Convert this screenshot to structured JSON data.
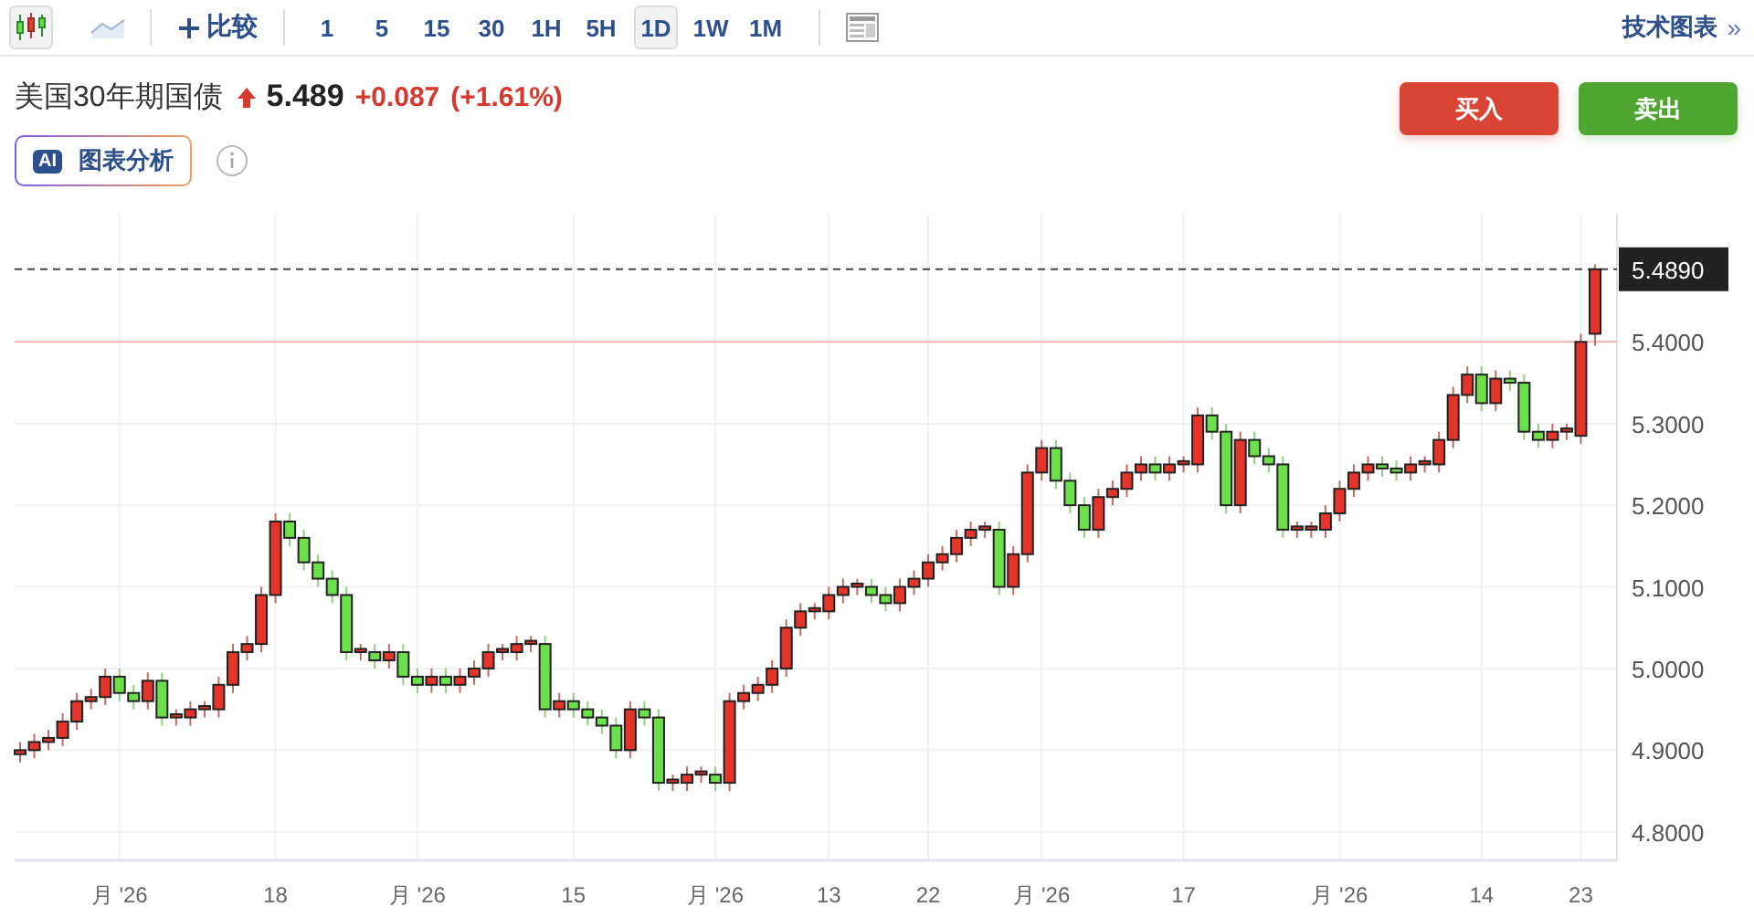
{
  "toolbar": {
    "chart_types": [
      {
        "kind": "candle",
        "selected": true
      },
      {
        "kind": "line",
        "selected": false
      }
    ],
    "compare": {
      "label": "比较"
    },
    "intervals": [
      {
        "label": "1",
        "selected": false
      },
      {
        "label": "5",
        "selected": false
      },
      {
        "label": "15",
        "selected": false
      },
      {
        "label": "30",
        "selected": false
      },
      {
        "label": "1H",
        "selected": false
      },
      {
        "label": "5H",
        "selected": false
      },
      {
        "label": "1D",
        "selected": true
      },
      {
        "label": "1W",
        "selected": false
      },
      {
        "label": "1M",
        "selected": false
      }
    ],
    "link": {
      "label": "技术图表",
      "chevron": "»"
    }
  },
  "quote": {
    "name": "美国30年期国债",
    "up": true,
    "price": "5.489",
    "change": "+0.087",
    "change_pct": "(+1.61%)"
  },
  "actions": [
    {
      "label": "买入",
      "kind": "buy"
    },
    {
      "label": "卖出",
      "kind": "sell"
    }
  ],
  "ai_button": {
    "badge": "AI",
    "label": "图表分析"
  },
  "chart": {
    "chart_data": {
      "type": "candlestick",
      "ylim": [
        4.765,
        5.557
      ],
      "yticks": [
        {
          "value": 5.4,
          "label": "5.4000"
        },
        {
          "value": 5.3,
          "label": "5.3000"
        },
        {
          "value": 5.2,
          "label": "5.2000"
        },
        {
          "value": 5.1,
          "label": "5.1000"
        },
        {
          "value": 5.0,
          "label": "5.0000"
        },
        {
          "value": 4.9,
          "label": "4.9000"
        },
        {
          "value": 4.8,
          "label": "4.8000"
        }
      ],
      "categories": [
        null,
        null,
        null,
        null,
        null,
        null,
        null,
        "月 '26",
        null,
        null,
        null,
        null,
        null,
        null,
        null,
        null,
        null,
        null,
        "18",
        null,
        null,
        null,
        null,
        null,
        null,
        null,
        null,
        null,
        "月 '26",
        null,
        null,
        null,
        null,
        null,
        null,
        null,
        null,
        null,
        null,
        "15",
        null,
        null,
        null,
        null,
        null,
        null,
        null,
        null,
        null,
        "月 '26",
        null,
        null,
        null,
        null,
        null,
        null,
        null,
        "13",
        null,
        null,
        null,
        null,
        null,
        null,
        "22",
        null,
        null,
        null,
        null,
        null,
        null,
        null,
        "月 '26",
        null,
        null,
        null,
        null,
        null,
        null,
        null,
        null,
        null,
        "17",
        null,
        null,
        null,
        null,
        null,
        null,
        null,
        null,
        null,
        null,
        "月 '26",
        null,
        null,
        null,
        null,
        null,
        null,
        null,
        null,
        null,
        "14",
        null,
        null,
        null,
        null,
        null,
        null,
        "23",
        null
      ],
      "ohlc": [
        [
          4.895,
          4.91,
          4.885,
          4.9
        ],
        [
          4.9,
          4.92,
          4.89,
          4.91
        ],
        [
          4.91,
          4.925,
          4.9,
          4.915
        ],
        [
          4.915,
          4.945,
          4.905,
          4.935
        ],
        [
          4.935,
          4.97,
          4.925,
          4.96
        ],
        [
          4.96,
          4.975,
          4.95,
          4.965
        ],
        [
          4.965,
          5.0,
          4.955,
          4.99
        ],
        [
          4.99,
          5.0,
          4.96,
          4.97
        ],
        [
          4.97,
          4.98,
          4.95,
          4.96
        ],
        [
          4.96,
          4.995,
          4.95,
          4.985
        ],
        [
          4.985,
          4.995,
          4.93,
          4.94
        ],
        [
          4.94,
          4.95,
          4.93,
          4.944
        ],
        [
          4.94,
          4.96,
          4.93,
          4.95
        ],
        [
          4.95,
          4.96,
          4.94,
          4.954
        ],
        [
          4.95,
          4.99,
          4.94,
          4.98
        ],
        [
          4.98,
          5.03,
          4.97,
          5.02
        ],
        [
          5.02,
          5.04,
          5.01,
          5.03
        ],
        [
          5.03,
          5.1,
          5.02,
          5.09
        ],
        [
          5.09,
          5.19,
          5.08,
          5.18
        ],
        [
          5.18,
          5.19,
          5.15,
          5.16
        ],
        [
          5.16,
          5.17,
          5.12,
          5.13
        ],
        [
          5.13,
          5.14,
          5.1,
          5.11
        ],
        [
          5.11,
          5.12,
          5.08,
          5.09
        ],
        [
          5.09,
          5.1,
          5.01,
          5.02
        ],
        [
          5.02,
          5.03,
          5.01,
          5.024
        ],
        [
          5.02,
          5.03,
          5.0,
          5.01
        ],
        [
          5.01,
          5.03,
          5.0,
          5.02
        ],
        [
          5.02,
          5.03,
          4.98,
          4.99
        ],
        [
          4.99,
          5.0,
          4.97,
          4.98
        ],
        [
          4.98,
          5.0,
          4.97,
          4.99
        ],
        [
          4.99,
          5.0,
          4.97,
          4.98
        ],
        [
          4.98,
          5.0,
          4.97,
          4.99
        ],
        [
          4.99,
          5.01,
          4.98,
          5.0
        ],
        [
          5.0,
          5.03,
          4.99,
          5.02
        ],
        [
          5.02,
          5.03,
          5.01,
          5.024
        ],
        [
          5.02,
          5.04,
          5.01,
          5.03
        ],
        [
          5.03,
          5.04,
          5.02,
          5.034
        ],
        [
          5.03,
          5.04,
          4.94,
          4.95
        ],
        [
          4.95,
          4.97,
          4.94,
          4.96
        ],
        [
          4.96,
          4.97,
          4.94,
          4.95
        ],
        [
          4.95,
          4.96,
          4.93,
          4.94
        ],
        [
          4.94,
          4.95,
          4.92,
          4.93
        ],
        [
          4.93,
          4.94,
          4.89,
          4.9
        ],
        [
          4.9,
          4.96,
          4.89,
          4.95
        ],
        [
          4.95,
          4.96,
          4.93,
          4.94
        ],
        [
          4.94,
          4.95,
          4.85,
          4.86
        ],
        [
          4.86,
          4.87,
          4.85,
          4.864
        ],
        [
          4.86,
          4.88,
          4.85,
          4.87
        ],
        [
          4.87,
          4.88,
          4.86,
          4.874
        ],
        [
          4.87,
          4.88,
          4.85,
          4.86
        ],
        [
          4.86,
          4.97,
          4.85,
          4.96
        ],
        [
          4.96,
          4.98,
          4.95,
          4.97
        ],
        [
          4.97,
          4.99,
          4.96,
          4.98
        ],
        [
          4.98,
          5.01,
          4.97,
          5.0
        ],
        [
          5.0,
          5.06,
          4.99,
          5.05
        ],
        [
          5.05,
          5.08,
          5.04,
          5.07
        ],
        [
          5.07,
          5.08,
          5.06,
          5.074
        ],
        [
          5.07,
          5.1,
          5.06,
          5.09
        ],
        [
          5.09,
          5.11,
          5.08,
          5.1
        ],
        [
          5.1,
          5.11,
          5.09,
          5.104
        ],
        [
          5.1,
          5.11,
          5.08,
          5.09
        ],
        [
          5.09,
          5.1,
          5.07,
          5.08
        ],
        [
          5.08,
          5.11,
          5.07,
          5.1
        ],
        [
          5.1,
          5.12,
          5.09,
          5.11
        ],
        [
          5.11,
          5.14,
          5.1,
          5.13
        ],
        [
          5.13,
          5.15,
          5.12,
          5.14
        ],
        [
          5.14,
          5.17,
          5.13,
          5.16
        ],
        [
          5.16,
          5.18,
          5.15,
          5.17
        ],
        [
          5.17,
          5.18,
          5.16,
          5.174
        ],
        [
          5.17,
          5.18,
          5.09,
          5.1
        ],
        [
          5.1,
          5.15,
          5.09,
          5.14
        ],
        [
          5.14,
          5.25,
          5.13,
          5.24
        ],
        [
          5.24,
          5.28,
          5.23,
          5.27
        ],
        [
          5.27,
          5.28,
          5.22,
          5.23
        ],
        [
          5.23,
          5.24,
          5.19,
          5.2
        ],
        [
          5.2,
          5.21,
          5.16,
          5.17
        ],
        [
          5.17,
          5.22,
          5.16,
          5.21
        ],
        [
          5.21,
          5.23,
          5.2,
          5.22
        ],
        [
          5.22,
          5.25,
          5.21,
          5.24
        ],
        [
          5.24,
          5.26,
          5.23,
          5.25
        ],
        [
          5.25,
          5.26,
          5.23,
          5.24
        ],
        [
          5.24,
          5.26,
          5.23,
          5.25
        ],
        [
          5.25,
          5.26,
          5.24,
          5.254
        ],
        [
          5.25,
          5.32,
          5.24,
          5.31
        ],
        [
          5.31,
          5.32,
          5.28,
          5.29
        ],
        [
          5.29,
          5.3,
          5.19,
          5.2
        ],
        [
          5.2,
          5.29,
          5.19,
          5.28
        ],
        [
          5.28,
          5.29,
          5.25,
          5.26
        ],
        [
          5.26,
          5.27,
          5.24,
          5.25
        ],
        [
          5.25,
          5.26,
          5.16,
          5.17
        ],
        [
          5.17,
          5.18,
          5.16,
          5.174
        ],
        [
          5.17,
          5.18,
          5.16,
          5.174
        ],
        [
          5.17,
          5.2,
          5.16,
          5.19
        ],
        [
          5.19,
          5.23,
          5.18,
          5.22
        ],
        [
          5.22,
          5.25,
          5.21,
          5.24
        ],
        [
          5.24,
          5.26,
          5.23,
          5.25
        ],
        [
          5.25,
          5.26,
          5.235,
          5.245
        ],
        [
          5.245,
          5.255,
          5.23,
          5.24
        ],
        [
          5.24,
          5.26,
          5.23,
          5.25
        ],
        [
          5.25,
          5.26,
          5.24,
          5.254
        ],
        [
          5.25,
          5.29,
          5.24,
          5.28
        ],
        [
          5.28,
          5.345,
          5.27,
          5.335
        ],
        [
          5.335,
          5.37,
          5.325,
          5.36
        ],
        [
          5.36,
          5.37,
          5.315,
          5.325
        ],
        [
          5.325,
          5.365,
          5.315,
          5.355
        ],
        [
          5.355,
          5.365,
          5.34,
          5.35
        ],
        [
          5.35,
          5.36,
          5.28,
          5.29
        ],
        [
          5.29,
          5.3,
          5.27,
          5.28
        ],
        [
          5.28,
          5.3,
          5.27,
          5.29
        ],
        [
          5.29,
          5.3,
          5.28,
          5.294
        ],
        [
          5.285,
          5.41,
          5.275,
          5.4
        ],
        [
          5.41,
          5.495,
          5.395,
          5.489
        ]
      ],
      "grid": true,
      "ref_lines": [
        {
          "axis": "y",
          "value": 5.489,
          "label": "5.4890",
          "color": "#444444"
        },
        {
          "axis": "y",
          "value": 5.4,
          "color": "#f6b3b0"
        }
      ]
    }
  }
}
